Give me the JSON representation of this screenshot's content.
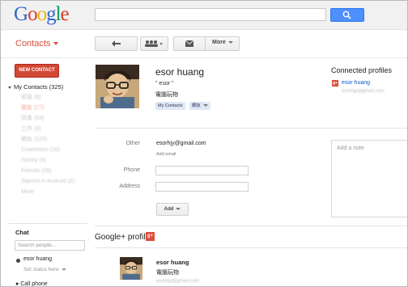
{
  "header": {
    "logo_letters": [
      {
        "ch": "G",
        "color": "#3366cc"
      },
      {
        "ch": "o",
        "color": "#dd3a2c"
      },
      {
        "ch": "o",
        "color": "#f2b50f"
      },
      {
        "ch": "g",
        "color": "#3366cc"
      },
      {
        "ch": "l",
        "color": "#0e9d58"
      },
      {
        "ch": "e",
        "color": "#dd3a2c"
      }
    ],
    "search_value": ""
  },
  "toolbar": {
    "app_title": "Contacts",
    "more_label": "More"
  },
  "sidebar": {
    "new_contact_label": "NEW CONTACT",
    "my_contacts_label": "My Contacts (325)",
    "items": [
      {
        "label": "家庭 (8)"
      },
      {
        "label": "朋友 (77)"
      },
      {
        "label": "同事 (93)"
      },
      {
        "label": "工作 (9)"
      },
      {
        "label": "網友 (126)"
      },
      {
        "label": "Coworkers (26)"
      },
      {
        "label": "Family (8)"
      },
      {
        "label": "Friends (28)"
      },
      {
        "label": "Starred in Android (8)"
      },
      {
        "label": "More"
      }
    ]
  },
  "chat": {
    "title": "Chat",
    "search_placeholder": "Search people...",
    "user_name": "esor huang",
    "status_label": "Set status here",
    "call_label": "Call phone"
  },
  "contact": {
    "name": "esor huang",
    "nickname": "\" esor \"",
    "company": "電腦玩物",
    "tags": [
      "My Contacts",
      "網友"
    ],
    "fields": {
      "other_label": "Other",
      "other_value": "esorhjy@gmail.com",
      "add_email_label": "Add email",
      "phone_label": "Phone",
      "address_label": "Address"
    },
    "add_button_label": "Add"
  },
  "gplus": {
    "section_title": "Google+ profile",
    "badge": "g+",
    "name": "esor huang",
    "company": "電腦玩物",
    "extra": "esorhjy@gmail.com"
  },
  "right": {
    "connected_title": "Connected profiles",
    "badge": "g+",
    "profile_name": "esor huang",
    "profile_email": "esorhjy@gmail.com",
    "note_placeholder": "Add a note"
  }
}
